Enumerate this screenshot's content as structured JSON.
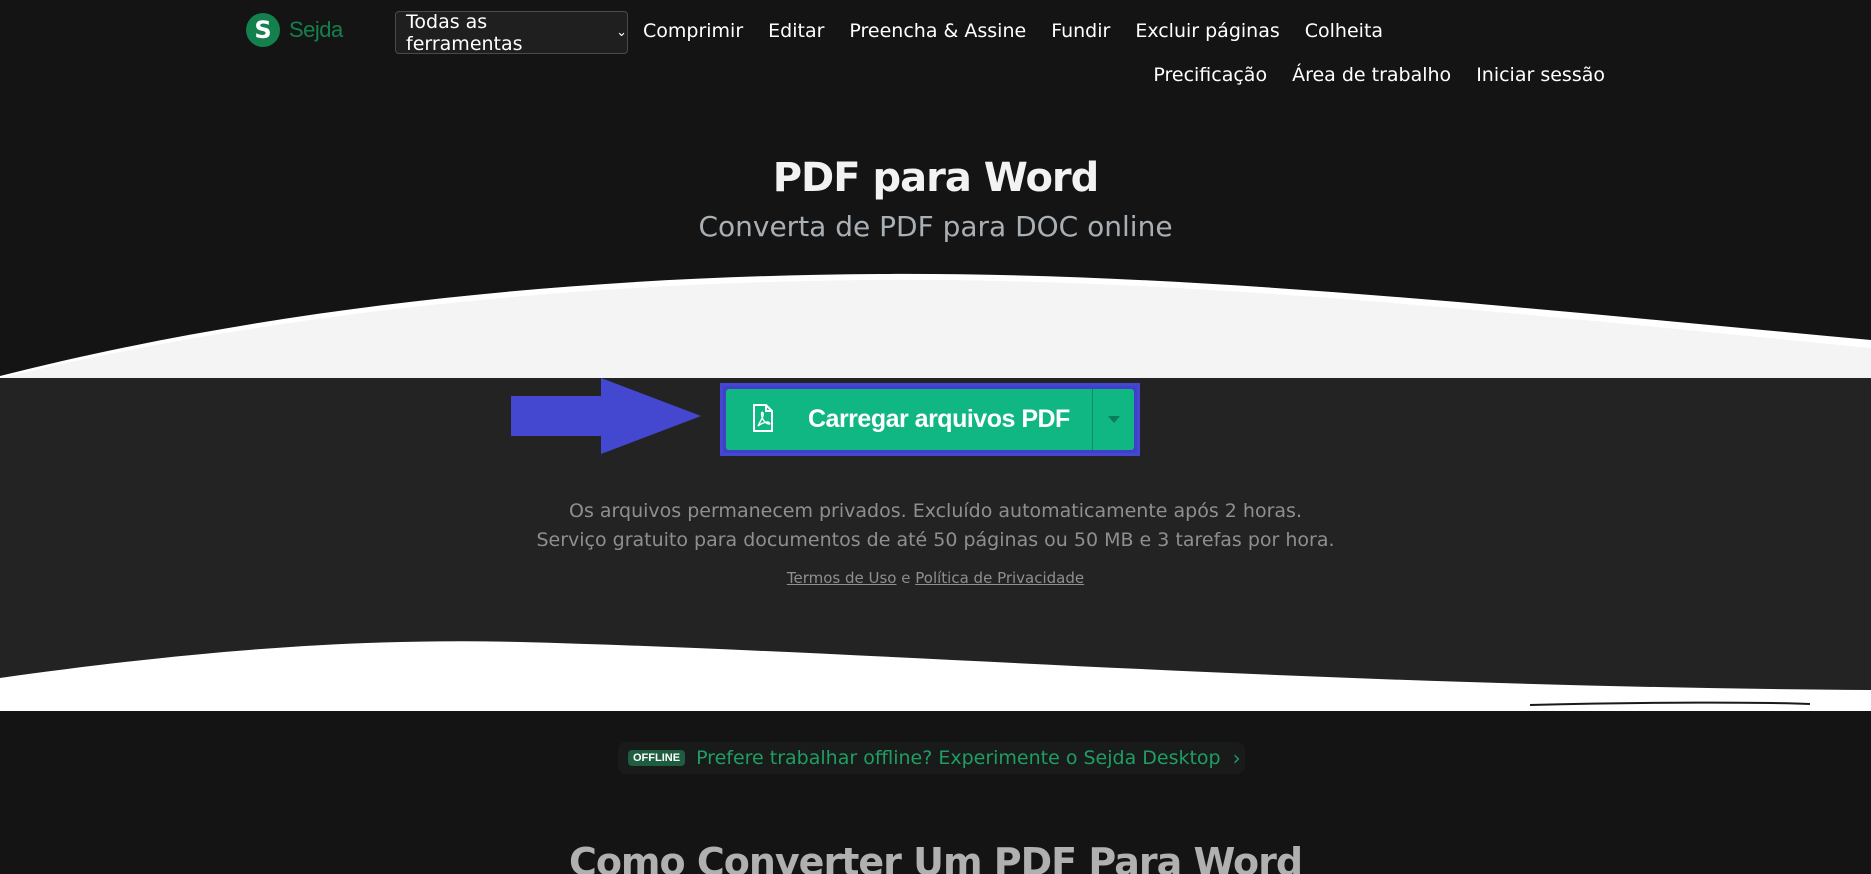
{
  "header": {
    "logo_letter": "S",
    "logo_text": "Sejda",
    "tools_label": "Todas as ferramentas",
    "nav_row1": [
      "Comprimir",
      "Editar",
      "Preencha & Assine",
      "Fundir",
      "Excluir páginas",
      "Colheita"
    ],
    "nav_row2": [
      "Precificação",
      "Área de trabalho",
      "Iniciar sessão"
    ]
  },
  "hero": {
    "title": "PDF para Word",
    "subtitle": "Converta de PDF para DOC online"
  },
  "upload": {
    "label": "Carregar arquivos PDF"
  },
  "info": {
    "line1": "Os arquivos permanecem privados. Excluído automaticamente após 2 horas.",
    "line2": "Serviço gratuito para documentos de até 50 páginas ou 50 MB e 3 tarefas por hora.",
    "terms": "Termos de Uso",
    "and": "e",
    "privacy": "Política de Privacidade"
  },
  "offline": {
    "badge": "OFFLINE",
    "text": "Prefere trabalhar offline? Experimente o Sejda Desktop"
  },
  "how": {
    "title": "Como Converter Um PDF Para Word"
  },
  "colors": {
    "brand": "#13804d",
    "button": "#10b782",
    "highlight": "#4447cf"
  }
}
